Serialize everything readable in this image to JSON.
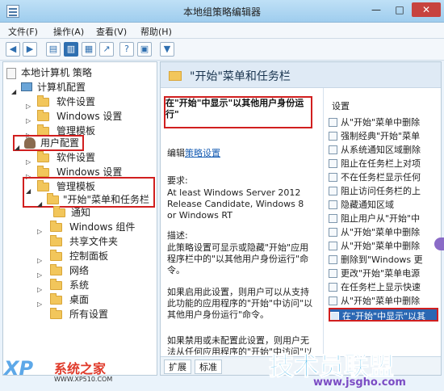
{
  "window": {
    "title": "本地组策略编辑器",
    "minimize": "—",
    "maximize": "□",
    "close": "✕"
  },
  "menu": [
    "文件(F)",
    "操作(A)",
    "查看(V)",
    "帮助(H)"
  ],
  "toolbar": {
    "back": "◀",
    "forward": "▶",
    "help": "?",
    "filter": "▼"
  },
  "tree": {
    "root": "本地计算机 策略",
    "computer_config": "计算机配置",
    "computer_children": [
      "软件设置",
      "Windows 设置",
      "管理模板"
    ],
    "user_config": "用户配置",
    "user_children": [
      "软件设置",
      "Windows 设置"
    ],
    "admin_templates": "管理模板",
    "start_menu": "\"开始\"菜单和任务栏",
    "notifications": "通知",
    "admin_children": [
      "Windows 组件",
      "共享文件夹",
      "控制面板",
      "网络",
      "系统",
      "桌面",
      "所有设置"
    ]
  },
  "section": {
    "title": "\"开始\"菜单和任务栏"
  },
  "description": {
    "title": "在\"开始\"中显示\"以其他用户身份运行\"",
    "edit_prefix": "编辑",
    "edit_link": "策略设置",
    "requirements_label": "要求:",
    "requirements_text": "At least Windows Server 2012 Release Candidate, Windows 8 or Windows RT",
    "desc_label": "描述:",
    "desc_text": "此策略设置可显示或隐藏\"开始\"应用程序栏中的\"以其他用户身份运行\"命令。",
    "enabled_text": "如果启用此设置，则用户可以从支持此功能的应用程序的\"开始\"中访问\"以其他用户身份运行\"命令。",
    "disabled_text": "如果禁用或未配置此设置，则用户无法从任何应用程序的\"开始\"中访问\"以其他用户身份运行\"命令。"
  },
  "settings": {
    "header": "设置",
    "items": [
      "从\"开始\"菜单中删除",
      "强制经典\"开始\"菜单",
      "从系统通知区域删除",
      "阻止在任务栏上对项",
      "不在任务栏显示任何",
      "阻止访问任务栏的上",
      "隐藏通知区域",
      "阻止用户从\"开始\"中",
      "从\"开始\"菜单中删除",
      "从\"开始\"菜单中删除",
      "删除到\"Windows 更",
      "更改\"开始\"菜单电源",
      "在任务栏上显示快速",
      "从\"开始\"菜单中删除",
      "在\"开始\"中显示\"以其"
    ]
  },
  "tabs": [
    "扩展",
    "标准"
  ],
  "watermarks": {
    "left_logo": "XP",
    "left_name": "系统之家",
    "left_url": "WWW.XP510.COM",
    "right_name": "技术员联盟",
    "right_url": "www.jsgho.com"
  },
  "colors": {
    "highlight": "#d11f1f",
    "selection": "#2a67b3",
    "link": "#1a5fb4"
  }
}
